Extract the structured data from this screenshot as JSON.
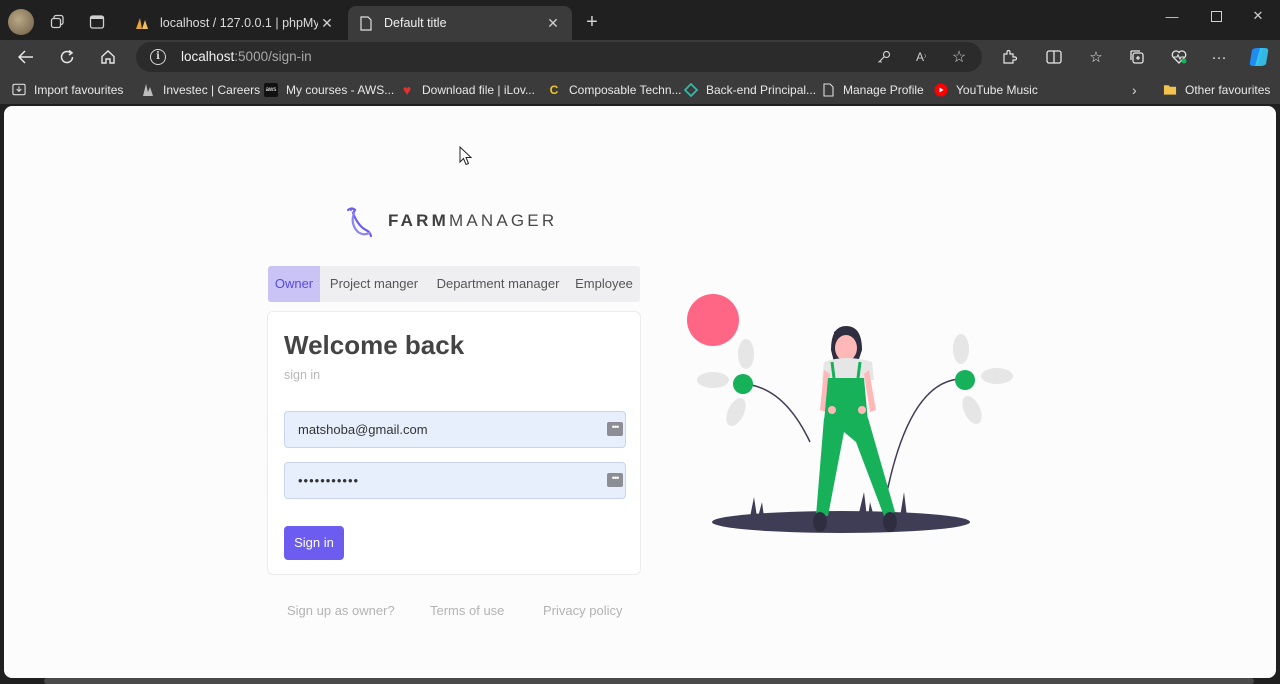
{
  "browser": {
    "tabs": [
      {
        "title": "localhost / 127.0.0.1 | phpMyAdmin",
        "active": false
      },
      {
        "title": "Default title",
        "active": true
      }
    ],
    "address": {
      "host": "localhost",
      "rest": ":5000/sign-in"
    },
    "favourites": [
      {
        "label": "Import favourites",
        "icon": "import-icon"
      },
      {
        "label": "Investec | Careers",
        "icon": "investec-icon"
      },
      {
        "label": "My courses - AWS...",
        "icon": "aws-icon"
      },
      {
        "label": "Download file | iLov...",
        "icon": "ilovepdf-icon"
      },
      {
        "label": "Composable Techn...",
        "icon": "composable-icon"
      },
      {
        "label": "Back-end Principal...",
        "icon": "diamond-icon"
      },
      {
        "label": "Manage Profile",
        "icon": "page-icon"
      },
      {
        "label": "YouTube Music",
        "icon": "youtube-music-icon"
      },
      {
        "label": "Other favourites",
        "icon": "folder-icon"
      }
    ]
  },
  "brand": {
    "bold": "FARM",
    "light": "MANAGER"
  },
  "roles": [
    "Owner",
    "Project manger",
    "Department manager",
    "Employee"
  ],
  "signin": {
    "heading": "Welcome back",
    "subheading": "sign in",
    "email_value": "matshoba@gmail.com",
    "password_value": "•••••••••••",
    "button": "Sign in"
  },
  "footer": [
    "Sign up as owner?",
    "Terms of use",
    "Privacy policy"
  ],
  "colors": {
    "accent": "#6c5cf0",
    "role_active_bg": "#c9c3f6",
    "illustration_green": "#16b159",
    "illustration_pink": "#ff6584"
  }
}
